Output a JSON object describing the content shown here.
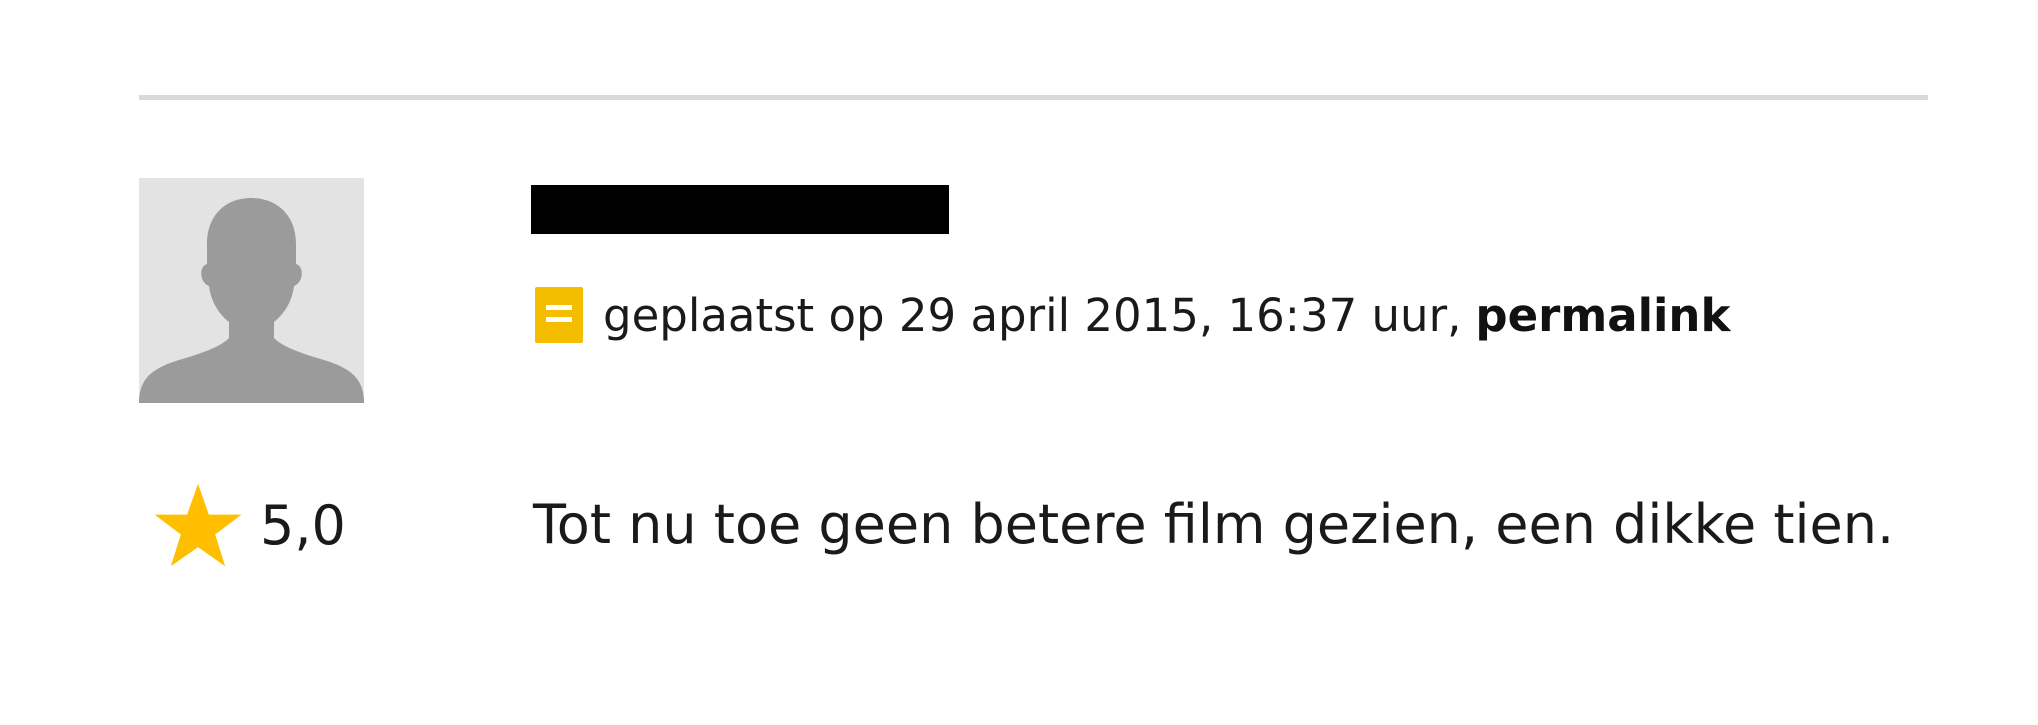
{
  "review": {
    "meta": {
      "posted_text": "geplaatst op 29 april 2015, 16:37 uur,",
      "permalink_label": "permalink",
      "icon": "note-icon",
      "icon_color": "#f5bd00"
    },
    "rating": {
      "value": "5,0",
      "icon": "star-icon",
      "star_color": "#ffbf00"
    },
    "text": "Tot nu toe geen betere film gezien, een dikke tien.",
    "avatar": {
      "icon": "user-silhouette-icon"
    }
  }
}
